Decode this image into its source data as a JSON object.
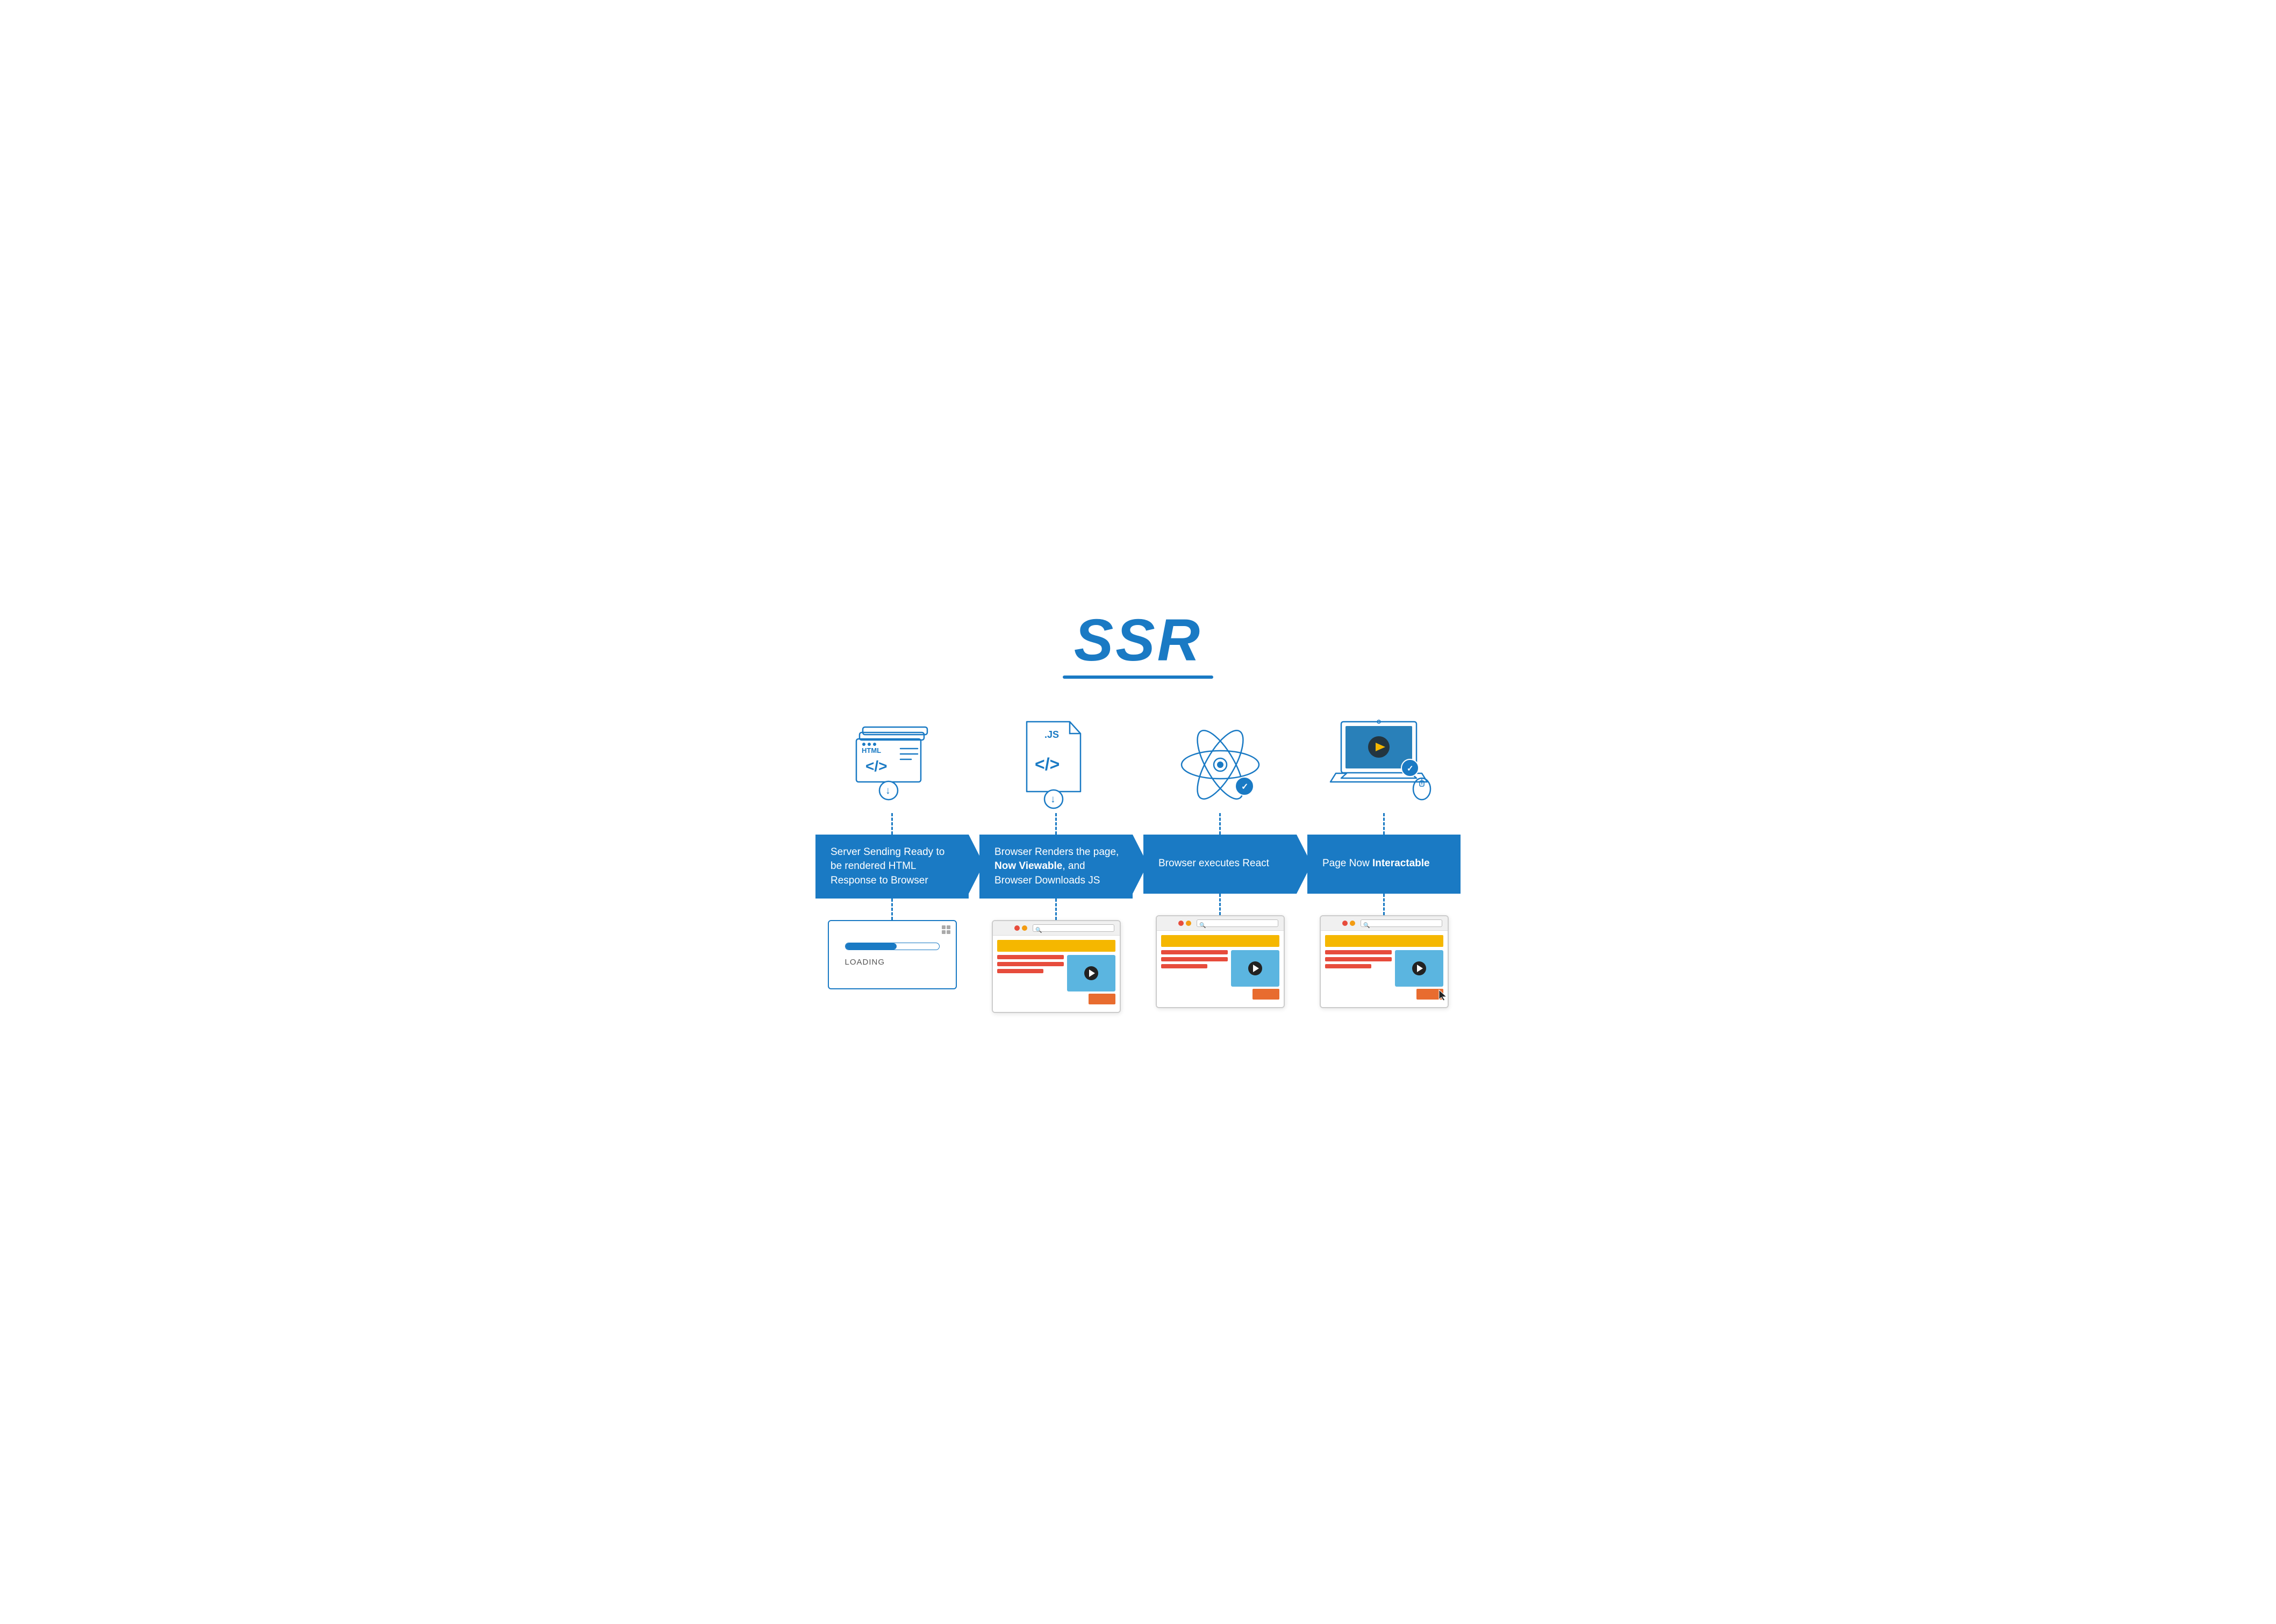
{
  "title": "SSR",
  "columns": [
    {
      "id": "col1",
      "icon": "html-stack",
      "box_text_line1": "Server Sending Ready",
      "box_text_line2": "to be rendered HTML",
      "box_text_line3": "Response to Browser",
      "box_bold": "",
      "screenshot": "loading"
    },
    {
      "id": "col2",
      "icon": "js-file",
      "box_text_line1": "Browser Renders the",
      "box_text_bold": "Now Viewable",
      "box_text_line2": "page,",
      "box_text_line3": ", and",
      "box_text_line4": "Browser Downloads JS",
      "screenshot": "browser-viewable"
    },
    {
      "id": "col3",
      "icon": "react-atom",
      "box_text_line1": "Browser",
      "box_text_line2": "executes React",
      "screenshot": "browser-executing"
    },
    {
      "id": "col4",
      "icon": "laptop",
      "box_text_line1": "Page Now",
      "box_text_bold": "Interactable",
      "screenshot": "browser-interactable"
    }
  ],
  "loading_label": "LOADING"
}
